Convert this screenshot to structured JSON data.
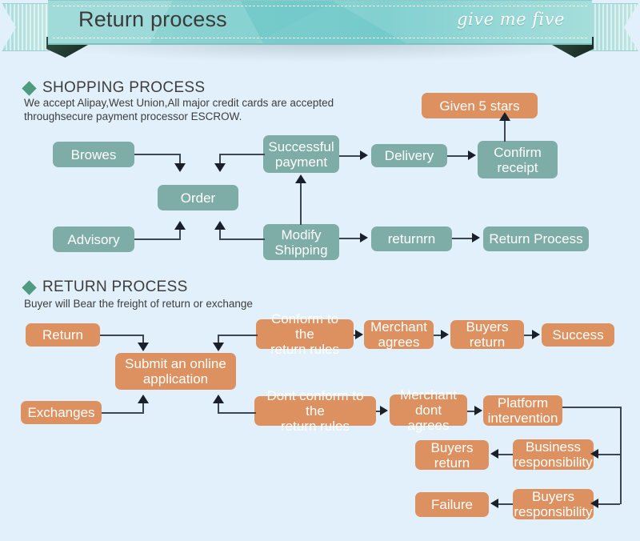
{
  "banner": {
    "title": "Return process",
    "tagline": "give me five"
  },
  "colors": {
    "background": "#e2f0fb",
    "teal": "#7eada8",
    "orange": "#dd9160",
    "banner_teal": "#8fd4d3",
    "diamond_green": "#4e9b80",
    "connector": "#3c4650"
  },
  "sections": [
    {
      "heading": "SHOPPING PROCESS",
      "subtitle": "We accept Alipay,West Union,All major credit cards are accepted\nthroughsecure payment processor ESCROW.",
      "nodes": [
        {
          "label": "Browes",
          "color": "teal"
        },
        {
          "label": "Order",
          "color": "teal"
        },
        {
          "label": "Advisory",
          "color": "teal"
        },
        {
          "label": "Successful\npayment",
          "color": "teal"
        },
        {
          "label": "Delivery",
          "color": "teal"
        },
        {
          "label": "Confirm\nreceipt",
          "color": "teal"
        },
        {
          "label": "Given 5 stars",
          "color": "orange"
        },
        {
          "label": "Modify\nShipping",
          "color": "teal"
        },
        {
          "label": "returnrn",
          "color": "teal"
        },
        {
          "label": "Return Process",
          "color": "teal"
        }
      ]
    },
    {
      "heading": "RETURN PROCESS",
      "subtitle": "Buyer will Bear the freight of return or exchange",
      "nodes": [
        {
          "label": "Return",
          "color": "orange"
        },
        {
          "label": "Submit an online\napplication",
          "color": "orange"
        },
        {
          "label": "Exchanges",
          "color": "orange"
        },
        {
          "label": "Conform to the\nreturn rules",
          "color": "orange"
        },
        {
          "label": "Merchant\nagrees",
          "color": "orange"
        },
        {
          "label": "Buyers\nreturn",
          "color": "orange"
        },
        {
          "label": "Success",
          "color": "orange"
        },
        {
          "label": "Dont conform to the\nreturn rules",
          "color": "orange"
        },
        {
          "label": "Merchant\ndont agrees",
          "color": "orange"
        },
        {
          "label": "Platform\nintervention",
          "color": "orange"
        },
        {
          "label": "Business\nresponsibility",
          "color": "orange"
        },
        {
          "label": "Buyers\nreturn",
          "color": "orange"
        },
        {
          "label": "Buyers\nresponsibility",
          "color": "orange"
        },
        {
          "label": "Failure",
          "color": "orange"
        }
      ]
    }
  ]
}
